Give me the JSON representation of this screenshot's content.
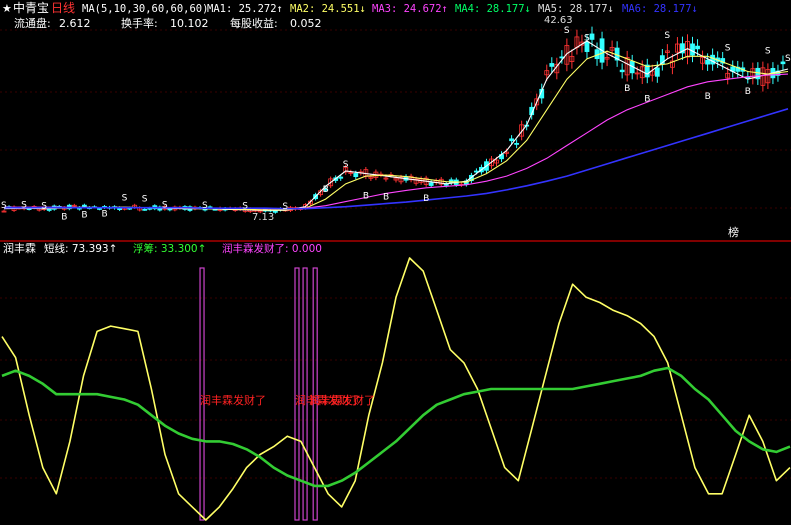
{
  "header": {
    "star": "★",
    "stock_name": "中青宝",
    "period": "日线",
    "ma_params": "MA(5,10,30,60,60,60)",
    "ma_values": [
      {
        "label": "MA1:",
        "value": "25.272",
        "arrow": "↑",
        "color": "#ffffff"
      },
      {
        "label": "MA2:",
        "value": "24.551",
        "arrow": "↓",
        "color": "#ffff66"
      },
      {
        "label": "MA3:",
        "value": "24.672",
        "arrow": "↑",
        "color": "#ff44ff"
      },
      {
        "label": "MA4:",
        "value": "28.177",
        "arrow": "↓",
        "color": "#00ff66"
      },
      {
        "label": "MA5:",
        "value": "28.177",
        "arrow": "↓",
        "color": "#dddddd"
      },
      {
        "label": "MA6:",
        "value": "28.177",
        "arrow": "↓",
        "color": "#3333ff"
      }
    ],
    "row2": [
      {
        "label": "流通盘:",
        "value": "2.612"
      },
      {
        "label": "换手率:",
        "value": "10.102"
      },
      {
        "label": "每股收益:",
        "value": "0.052"
      }
    ],
    "price_label": "42.63",
    "low_label": "7.13",
    "board_label": "榜"
  },
  "indicator": {
    "name": "润丰霖",
    "items": [
      {
        "label": "短线:",
        "value": "73.393",
        "arrow": "↑",
        "color": "#ffffff"
      },
      {
        "label": "浮筹:",
        "value": "33.300",
        "arrow": "↑",
        "color": "#33ff33"
      },
      {
        "label": "润丰霖发财了:",
        "value": "0.000",
        "arrow": "",
        "color": "#ff44ff"
      }
    ],
    "signal_text": "润丰霖发财了",
    "colors": {
      "short": "#ffff66",
      "float": "#33cc33",
      "signal": "#cc44cc",
      "signal_text": "#ff2222"
    }
  },
  "chart_data": [
    {
      "type": "candlestick",
      "title": "中青宝 日线",
      "ylim": [
        5,
        45
      ],
      "series": [
        {
          "name": "MA1",
          "values": [
            7.6,
            7.7,
            7.6,
            7.8,
            7.9,
            7.8,
            7.9,
            7.8,
            7.7,
            7.6,
            7.6,
            7.5,
            7.4,
            7.3,
            7.3,
            8.0,
            12.0,
            15.0,
            14.5,
            14.0,
            13.5,
            13.0,
            12.5,
            13.0,
            16.0,
            19.0,
            24.0,
            33.0,
            38.0,
            40.5,
            38.0,
            36.0,
            34.0,
            37.0,
            39.0,
            37.0,
            35.0,
            33.0,
            34.0,
            35.0
          ]
        },
        {
          "name": "MA2",
          "values": [
            7.8,
            7.8,
            7.7,
            7.7,
            7.8,
            7.8,
            7.9,
            7.8,
            7.8,
            7.7,
            7.6,
            7.6,
            7.5,
            7.4,
            7.4,
            7.7,
            9.5,
            12.5,
            14.0,
            14.2,
            13.9,
            13.4,
            12.9,
            12.8,
            14.5,
            17.0,
            21.0,
            27.0,
            33.0,
            37.0,
            38.5,
            37.0,
            35.5,
            36.0,
            37.5,
            37.5,
            36.0,
            34.5,
            34.0,
            34.5
          ]
        },
        {
          "name": "MA3",
          "values": [
            7.9,
            7.9,
            7.9,
            7.9,
            7.8,
            7.8,
            7.8,
            7.8,
            7.8,
            7.8,
            7.7,
            7.7,
            7.7,
            7.6,
            7.6,
            7.7,
            8.2,
            9.0,
            9.8,
            10.6,
            11.2,
            11.7,
            12.0,
            12.3,
            13.0,
            14.0,
            15.5,
            17.5,
            20.0,
            22.5,
            25.0,
            27.0,
            28.5,
            30.0,
            31.5,
            32.5,
            33.0,
            33.5,
            33.8,
            34.0
          ]
        },
        {
          "name": "MA4",
          "values": [
            7.8,
            7.8,
            7.8,
            7.8,
            7.8,
            7.8,
            7.8,
            7.8,
            7.8,
            7.8,
            7.7,
            7.7,
            7.7,
            7.7,
            7.6,
            7.6,
            7.8,
            8.0,
            8.3,
            8.6,
            8.9,
            9.3,
            9.7,
            10.1,
            10.6,
            11.3,
            12.1,
            13.0,
            14.0,
            15.2,
            16.4,
            17.6,
            18.8,
            20.0,
            21.2,
            22.4,
            23.6,
            24.8,
            26.0,
            27.2
          ]
        }
      ],
      "annotations": {
        "B": [
          [
            3,
            7.8
          ],
          [
            4,
            8.2
          ],
          [
            5,
            8.4
          ],
          [
            16,
            13.2
          ],
          [
            18,
            12.0
          ],
          [
            19,
            11.8
          ],
          [
            21,
            11.5
          ],
          [
            31,
            33.0
          ],
          [
            32,
            31.0
          ],
          [
            35,
            31.5
          ],
          [
            37,
            32.5
          ]
        ],
        "S": [
          [
            0,
            7.2
          ],
          [
            1,
            7.3
          ],
          [
            2,
            7.1
          ],
          [
            6,
            8.6
          ],
          [
            7,
            8.4
          ],
          [
            8,
            7.3
          ],
          [
            10,
            7.2
          ],
          [
            12,
            7.1
          ],
          [
            14,
            7.0
          ],
          [
            17,
            15.2
          ],
          [
            28,
            41.5
          ],
          [
            29,
            40.0
          ],
          [
            33,
            40.5
          ],
          [
            36,
            38.0
          ],
          [
            38,
            37.5
          ],
          [
            39,
            36.0
          ]
        ]
      }
    },
    {
      "type": "line",
      "series": [
        {
          "name": "短线",
          "values": [
            70,
            62,
            40,
            20,
            10,
            30,
            55,
            72,
            74,
            73,
            72,
            50,
            25,
            10,
            5,
            0,
            5,
            12,
            20,
            25,
            28,
            32,
            30,
            20,
            10,
            5,
            15,
            40,
            60,
            85,
            100,
            95,
            80,
            65,
            60,
            50,
            35,
            20,
            15,
            35,
            55,
            75,
            90,
            85,
            83,
            80,
            78,
            75,
            70,
            60,
            40,
            20,
            10,
            10,
            25,
            40,
            30,
            15,
            20
          ]
        },
        {
          "name": "浮筹",
          "values": [
            55,
            57,
            55,
            52,
            48,
            48,
            48,
            48,
            47,
            46,
            44,
            40,
            36,
            33,
            31,
            30,
            30,
            29,
            27,
            24,
            20,
            17,
            15,
            13,
            13,
            15,
            18,
            22,
            26,
            30,
            35,
            40,
            44,
            46,
            48,
            49,
            50,
            50,
            50,
            50,
            50,
            50,
            50,
            51,
            52,
            53,
            54,
            55,
            57,
            58,
            55,
            50,
            46,
            40,
            34,
            30,
            27,
            26,
            28
          ]
        }
      ],
      "signals": [
        9.9,
        14.6,
        15.0,
        15.5
      ]
    }
  ]
}
